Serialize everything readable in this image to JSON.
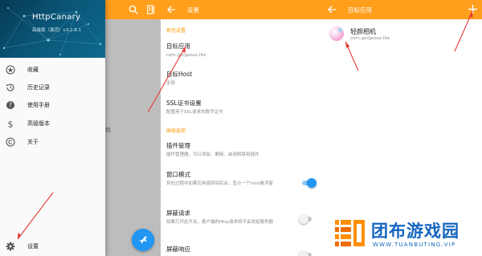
{
  "drawer": {
    "app_title": "HttpCanary",
    "app_version": "高级版（激活）v3.2.8.1",
    "menu": [
      {
        "icon": "bookmark-icon",
        "label": "收藏"
      },
      {
        "icon": "history-icon",
        "label": "历史记录"
      },
      {
        "icon": "help-icon",
        "label": "使用手册"
      },
      {
        "icon": "dollar-icon",
        "label": "高级版本"
      },
      {
        "icon": "copyright-icon",
        "label": "关于"
      },
      {
        "icon": "gear-icon",
        "label": "设置"
      }
    ],
    "background_fragment": "包"
  },
  "settings": {
    "title": "设置",
    "section_capture": "抓包设置",
    "section_advanced": "高级选项",
    "prefs": [
      {
        "title": "目标应用",
        "summary": "com.gorgeous.lite"
      },
      {
        "title": "目标Host",
        "summary": "全部"
      },
      {
        "title": "SSL证书设置",
        "summary": "配置用于SSL请求的数字证书"
      },
      {
        "title": "插件管理",
        "summary": "插件管理器，可以添加、删除、启用和禁用插件"
      },
      {
        "title": "窗口模式",
        "summary": "抓包过程中如果应用退回到后台，显示一个mini悬浮窗",
        "toggle": true
      },
      {
        "title": "屏蔽请求",
        "summary": "如果打开此开关，客户端的Http请求将不会发给服务器",
        "toggle": false
      },
      {
        "title": "屏蔽响应",
        "summary": "",
        "toggle": false
      }
    ]
  },
  "target": {
    "title": "目标应用",
    "app_name": "轻颜相机",
    "app_package": "com.gorgeous.lite"
  },
  "watermark": {
    "main": "团布游戏园",
    "sub": "WWW.TUANBUTING.VIP"
  },
  "colors": {
    "app_bar": "#ff9f1c",
    "accent": "#ff9800",
    "switch_on": "#2196f3",
    "annotation": "#e53935"
  }
}
